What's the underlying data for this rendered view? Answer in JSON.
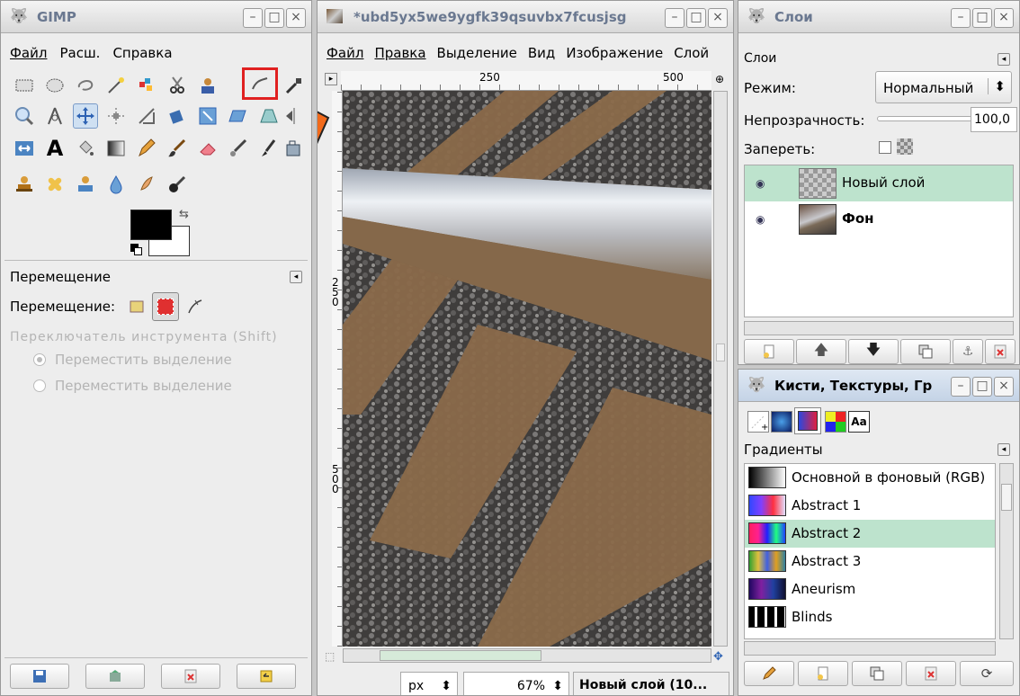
{
  "toolbox": {
    "title": "GIMP",
    "menu": [
      "Файл",
      "Расш.",
      "Справка"
    ],
    "options_title": "Перемещение",
    "move_label": "Перемещение:",
    "faded_line": "Переключатель инструмента (Shift)",
    "radio1": "Переместить выделение",
    "radio2": "Переместить выделение",
    "fg_color": "#000000",
    "bg_color": "#ffffff"
  },
  "image_window": {
    "title": "*ubd5yx5we9ygfk39qsuvbx7fcusjsg",
    "menu": [
      "Файл",
      "Правка",
      "Выделение",
      "Вид",
      "Изображение",
      "Слой"
    ],
    "ruler_h": [
      "250",
      "500"
    ],
    "ruler_v": [
      "250",
      "500"
    ],
    "unit": "px",
    "zoom": "67%",
    "status": "Новый слой (10..."
  },
  "layers": {
    "title": "Слои",
    "tab_label": "Слои",
    "mode_label": "Режим:",
    "mode_value": "Нормальный",
    "opacity_label": "Непрозрачность:",
    "opacity_value": "100,0",
    "lock_label": "Запереть:",
    "items": [
      {
        "name": "Новый слой",
        "selected": true
      },
      {
        "name": "Фон",
        "selected": false
      }
    ]
  },
  "brushes": {
    "title": "Кисти, Текстуры, Гр",
    "tab_label": "Градиенты",
    "gradients": [
      {
        "name": "Основной в фоновый (RGB)",
        "selected": false
      },
      {
        "name": "Abstract 1",
        "selected": false
      },
      {
        "name": "Abstract 2",
        "selected": true
      },
      {
        "name": "Abstract 3",
        "selected": false
      },
      {
        "name": "Aneurism",
        "selected": false
      },
      {
        "name": "Blinds",
        "selected": false
      }
    ]
  },
  "colors": {
    "selection": "#bde3cd",
    "arrow": "#f26a1b",
    "highlight_box": "#e02020",
    "title_text": "#6a7890"
  }
}
